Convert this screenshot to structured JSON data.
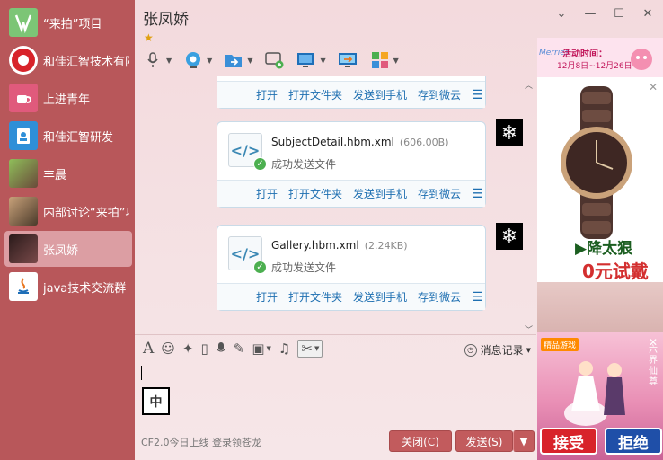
{
  "sidebar": {
    "conversations": [
      {
        "name": "“来拍”项目",
        "avatar_color": "#7cc576",
        "active": false
      },
      {
        "name": "和佳汇智技术有限",
        "avatar_color": "#d8232a",
        "active": false
      },
      {
        "name": "上进青年",
        "avatar_color": "#e05a7c",
        "active": false
      },
      {
        "name": "和佳汇智研发",
        "avatar_color": "#2f8fd8",
        "active": false
      },
      {
        "name": "丰晨",
        "avatar_color": "#6a4a3a",
        "active": false
      },
      {
        "name": "内部讨论“来拍”项",
        "avatar_color": "#8a6a5a",
        "active": false
      },
      {
        "name": "张凤娇",
        "avatar_color": "#3a2a2a",
        "active": true
      },
      {
        "name": "java技术交流群",
        "avatar_color": "#e87722",
        "active": false
      }
    ]
  },
  "header": {
    "title": "张凤娇",
    "star": "★"
  },
  "window_controls": {
    "settings": "⌄",
    "minimize": "—",
    "maximize": "☐",
    "close": "✕"
  },
  "toolbar": {
    "items": [
      "microphone-icon",
      "webcam-icon",
      "send-file-icon",
      "create-discussion-icon",
      "remote-desktop-icon",
      "share-screen-icon",
      "apps-icon"
    ]
  },
  "messages": [
    {
      "file_name": "",
      "file_size": "",
      "status": "",
      "actions": [
        "打开",
        "打开文件夹",
        "发送到手机",
        "存到微云"
      ]
    },
    {
      "file_name": "SubjectDetail.hbm.xml",
      "file_size": "(606.00B)",
      "status": "成功发送文件",
      "actions": [
        "打开",
        "打开文件夹",
        "发送到手机",
        "存到微云"
      ]
    },
    {
      "file_name": "Gallery.hbm.xml",
      "file_size": "(2.24KB)",
      "status": "成功发送文件",
      "actions": [
        "打开",
        "打开文件夹",
        "发送到手机",
        "存到微云"
      ]
    }
  ],
  "input_toolbar": {
    "history_label": "消息记录"
  },
  "editor": {
    "ime_indicator": "中"
  },
  "footer": {
    "status_text": "CF2.0今日上线 登录领苍龙",
    "close_label": "关闭(C)",
    "send_label": "发送(S)"
  },
  "ads": {
    "top": {
      "logo": "Merries",
      "line1": "活动时间：",
      "line2": "12月8日~12月26日"
    },
    "watch": {
      "brand": "▶降太狠",
      "offer": "0元试戴"
    },
    "game": {
      "tag": "精品游戏",
      "side_text": "六界仙尊",
      "accept": "接受",
      "reject": "拒绝"
    }
  }
}
